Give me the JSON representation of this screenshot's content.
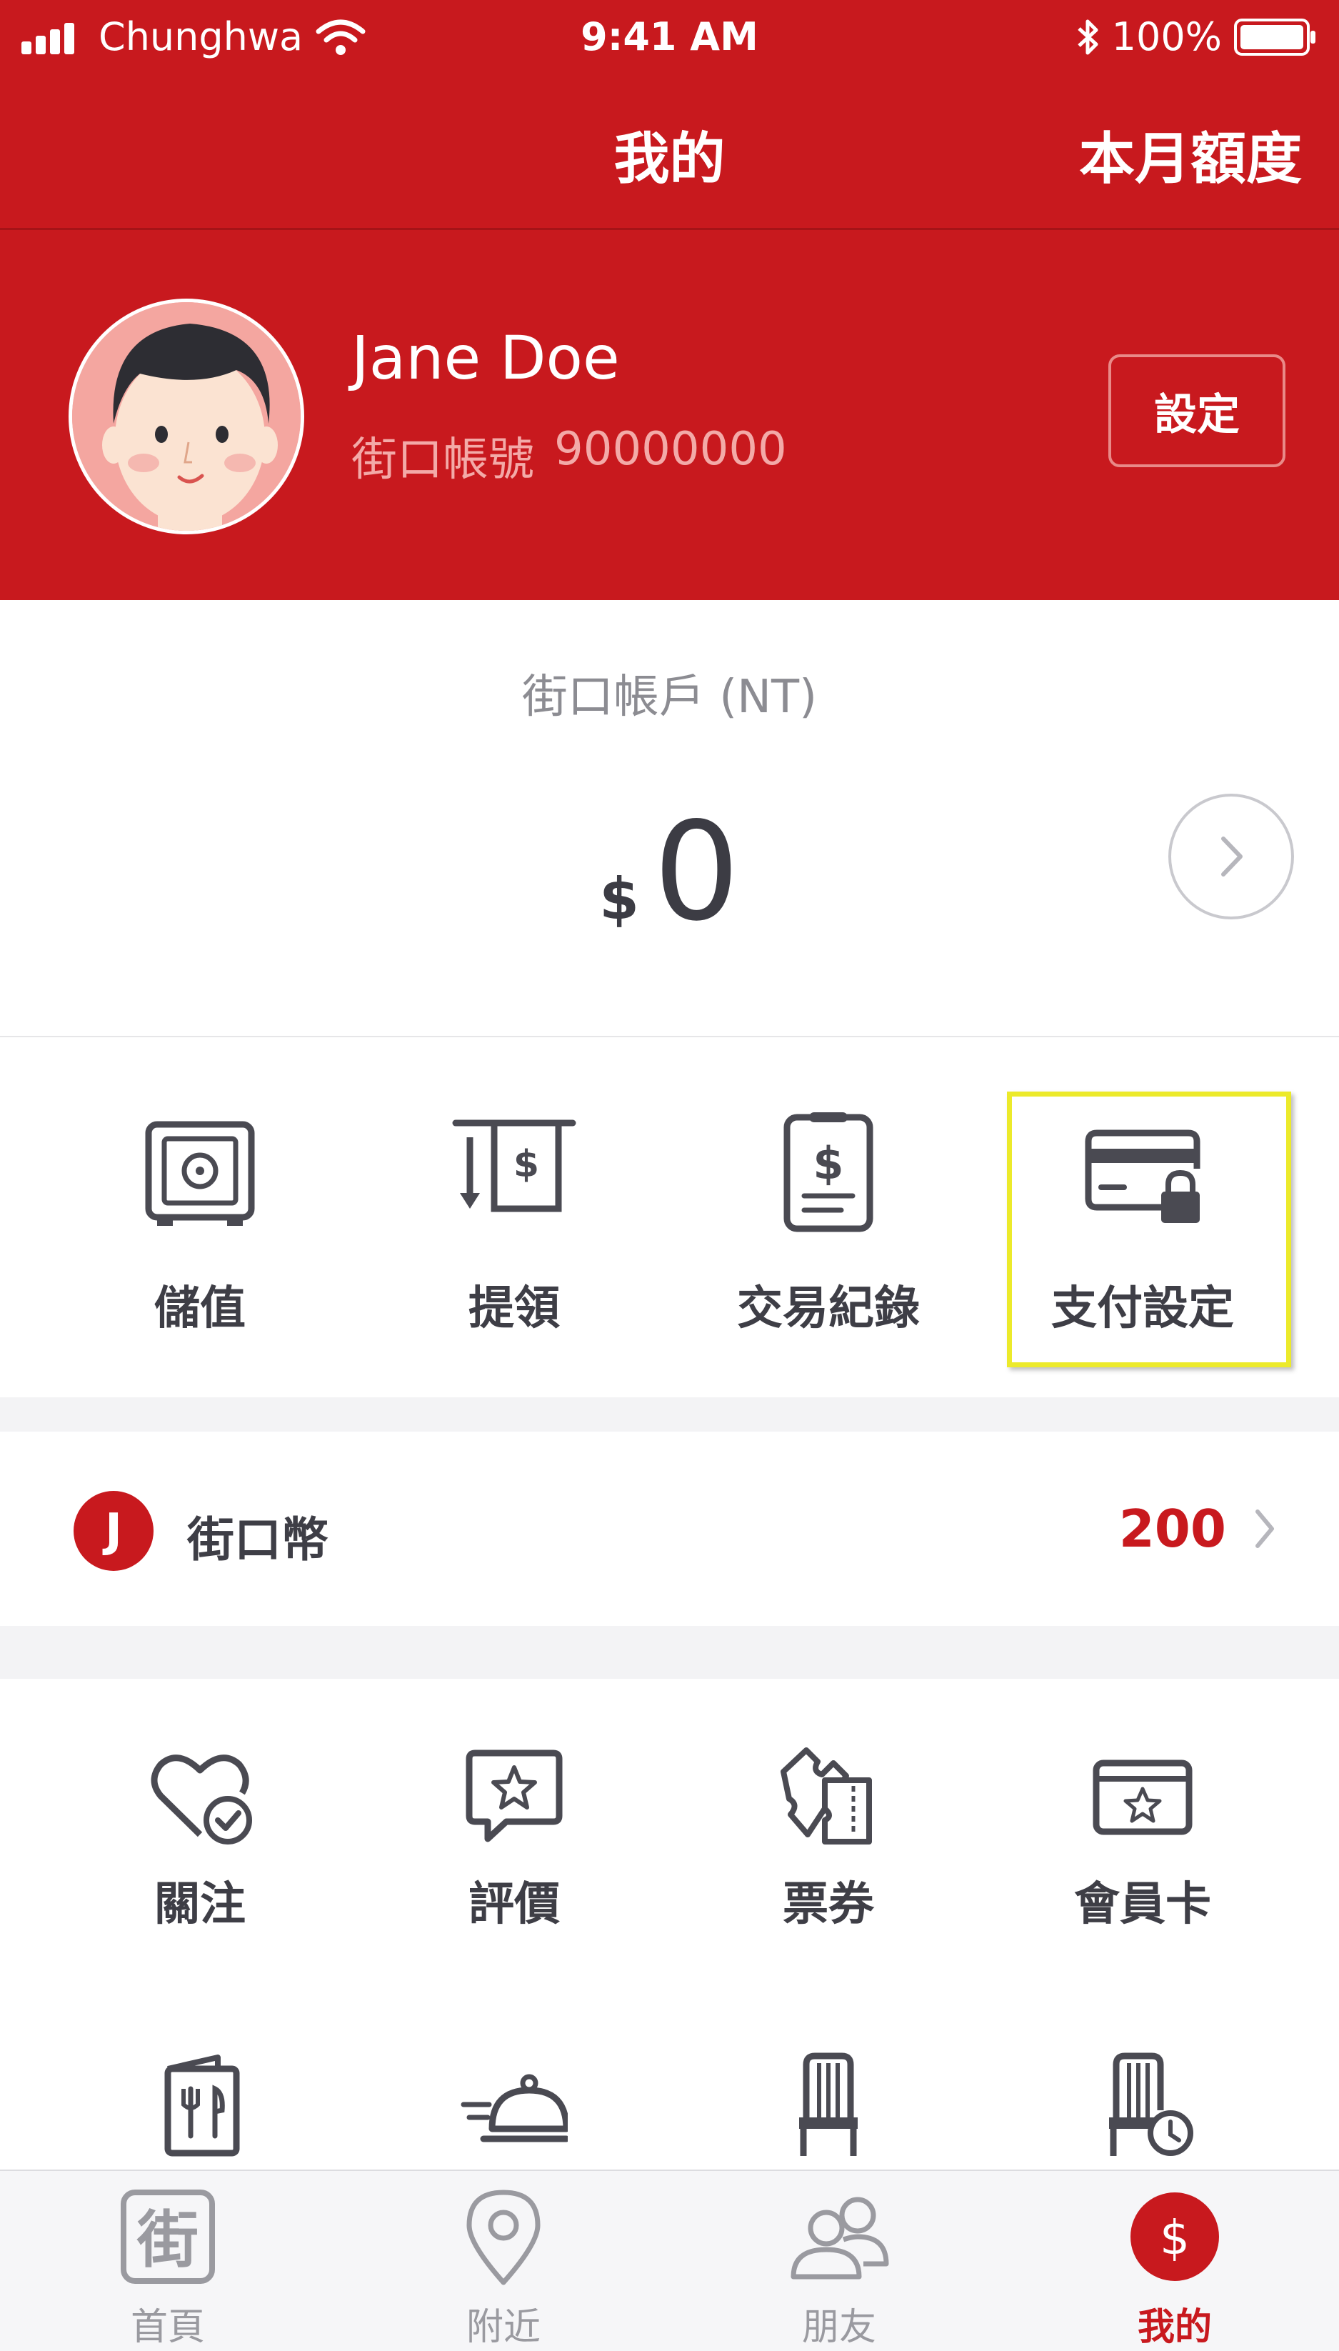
{
  "status_bar": {
    "carrier": "Chunghwa",
    "time": "9:41 AM",
    "battery": "100%"
  },
  "nav": {
    "title": "我的",
    "right_action": "本月額度"
  },
  "profile": {
    "name": "Jane Doe",
    "account_label": "街口帳號",
    "account_number": "90000000",
    "settings_button": "設定"
  },
  "balance": {
    "label": "街口帳戶 (NT)",
    "currency_symbol": "$",
    "amount": "0"
  },
  "actions": [
    {
      "label": "儲值",
      "icon": "safe-icon"
    },
    {
      "label": "提領",
      "icon": "withdraw-icon"
    },
    {
      "label": "交易紀錄",
      "icon": "receipt-icon"
    },
    {
      "label": "支付設定",
      "icon": "card-lock-icon",
      "highlighted": true
    }
  ],
  "coin": {
    "badge": "J",
    "label": "街口幣",
    "value": "200"
  },
  "features": [
    {
      "label": "關注",
      "icon": "heart-check-icon"
    },
    {
      "label": "評價",
      "icon": "star-message-icon"
    },
    {
      "label": "票券",
      "icon": "ticket-icon"
    },
    {
      "label": "會員卡",
      "icon": "member-card-icon"
    }
  ],
  "tabs": [
    {
      "label": "首頁",
      "icon": "home-jie-icon"
    },
    {
      "label": "附近",
      "icon": "location-pin-icon"
    },
    {
      "label": "朋友",
      "icon": "friends-icon"
    },
    {
      "label": "我的",
      "icon": "dollar-circle-icon",
      "active": true
    }
  ],
  "colors": {
    "brand_red": "#c8191e",
    "highlight": "#ecea2b",
    "text_dark": "#3e3e46",
    "text_muted": "#8c8c92"
  }
}
